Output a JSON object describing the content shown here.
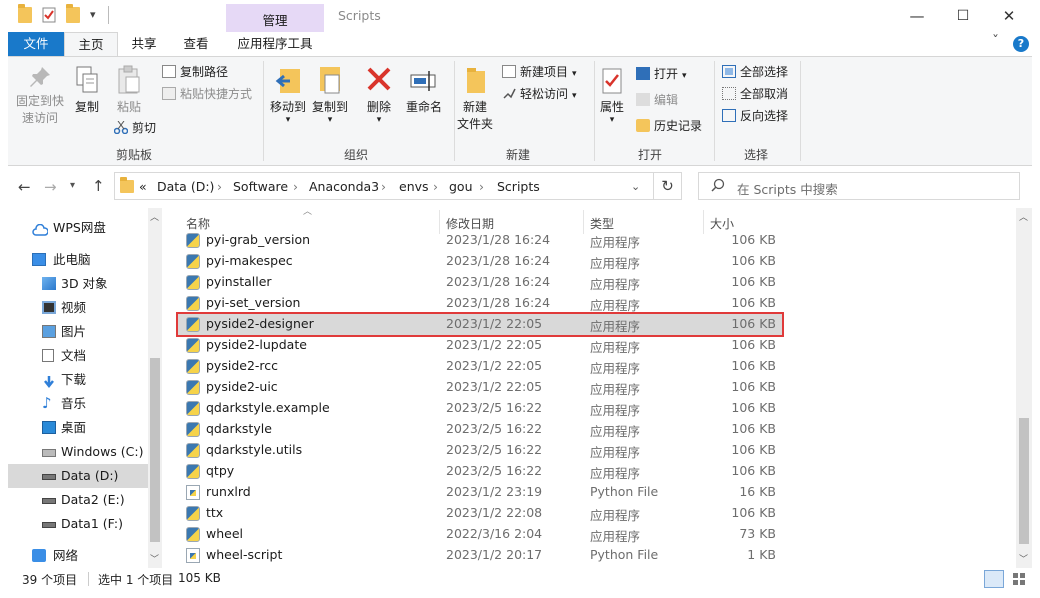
{
  "window": {
    "context_tab": "管理",
    "title": "Scripts",
    "minimize": "—",
    "maximize": "☐",
    "close": "✕"
  },
  "tabs": {
    "file": "文件",
    "home": "主页",
    "share": "共享",
    "view": "查看",
    "app_tools": "应用程序工具",
    "collapse": "ˇ",
    "help": "?"
  },
  "ribbon": {
    "pin_line1": "固定到快",
    "pin_line2": "速访问",
    "copy": "复制",
    "paste": "粘贴",
    "copy_path": "复制路径",
    "paste_shortcut": "粘贴快捷方式",
    "cut": "剪切",
    "clipboard_group": "剪贴板",
    "move_to": "移动到",
    "copy_to": "复制到",
    "delete": "删除",
    "rename": "重命名",
    "organize_group": "组织",
    "new_folder_line1": "新建",
    "new_folder_line2": "文件夹",
    "new_item": "新建项目",
    "easy_access": "轻松访问",
    "new_group": "新建",
    "properties": "属性",
    "open": "打开",
    "edit": "编辑",
    "history": "历史记录",
    "open_group": "打开",
    "select_all": "全部选择",
    "select_none": "全部取消",
    "invert_selection": "反向选择",
    "select_group": "选择"
  },
  "address": {
    "overflow": "«",
    "crumbs": [
      "Data (D:)",
      "Software",
      "Anaconda3",
      "envs",
      "gou",
      "Scripts"
    ],
    "search_placeholder": "在 Scripts 中搜索"
  },
  "nav": {
    "items": [
      {
        "label": "WPS网盘"
      },
      {
        "label": "此电脑"
      },
      {
        "label": "3D 对象"
      },
      {
        "label": "视频"
      },
      {
        "label": "图片"
      },
      {
        "label": "文档"
      },
      {
        "label": "下载"
      },
      {
        "label": "音乐"
      },
      {
        "label": "桌面"
      },
      {
        "label": "Windows (C:)"
      },
      {
        "label": "Data (D:)"
      },
      {
        "label": "Data2 (E:)"
      },
      {
        "label": "Data1 (F:)"
      },
      {
        "label": "网络"
      }
    ]
  },
  "columns": {
    "name": "名称",
    "date": "修改日期",
    "type": "类型",
    "size": "大小"
  },
  "files": [
    {
      "name": "pyi-grab_version",
      "date": "2023/1/28 16:24",
      "type": "应用程序",
      "size": "106 KB",
      "icon": "python-exe-icon"
    },
    {
      "name": "pyi-makespec",
      "date": "2023/1/28 16:24",
      "type": "应用程序",
      "size": "106 KB",
      "icon": "python-exe-icon"
    },
    {
      "name": "pyinstaller",
      "date": "2023/1/28 16:24",
      "type": "应用程序",
      "size": "106 KB",
      "icon": "python-exe-icon"
    },
    {
      "name": "pyi-set_version",
      "date": "2023/1/28 16:24",
      "type": "应用程序",
      "size": "106 KB",
      "icon": "python-exe-icon"
    },
    {
      "name": "pyside2-designer",
      "date": "2023/1/2 22:05",
      "type": "应用程序",
      "size": "106 KB",
      "icon": "python-exe-icon"
    },
    {
      "name": "pyside2-lupdate",
      "date": "2023/1/2 22:05",
      "type": "应用程序",
      "size": "106 KB",
      "icon": "python-exe-icon"
    },
    {
      "name": "pyside2-rcc",
      "date": "2023/1/2 22:05",
      "type": "应用程序",
      "size": "106 KB",
      "icon": "python-exe-icon"
    },
    {
      "name": "pyside2-uic",
      "date": "2023/1/2 22:05",
      "type": "应用程序",
      "size": "106 KB",
      "icon": "python-exe-icon"
    },
    {
      "name": "qdarkstyle.example",
      "date": "2023/2/5 16:22",
      "type": "应用程序",
      "size": "106 KB",
      "icon": "python-exe-icon"
    },
    {
      "name": "qdarkstyle",
      "date": "2023/2/5 16:22",
      "type": "应用程序",
      "size": "106 KB",
      "icon": "python-exe-icon"
    },
    {
      "name": "qdarkstyle.utils",
      "date": "2023/2/5 16:22",
      "type": "应用程序",
      "size": "106 KB",
      "icon": "python-exe-icon"
    },
    {
      "name": "qtpy",
      "date": "2023/2/5 16:22",
      "type": "应用程序",
      "size": "106 KB",
      "icon": "python-exe-icon"
    },
    {
      "name": "runxlrd",
      "date": "2023/1/2 23:19",
      "type": "Python File",
      "size": "16 KB",
      "icon": "python-file-icon"
    },
    {
      "name": "ttx",
      "date": "2023/1/2 22:08",
      "type": "应用程序",
      "size": "106 KB",
      "icon": "python-exe-icon"
    },
    {
      "name": "wheel",
      "date": "2022/3/16 2:04",
      "type": "应用程序",
      "size": "73 KB",
      "icon": "python-exe-icon"
    },
    {
      "name": "wheel-script",
      "date": "2023/1/2 20:17",
      "type": "Python File",
      "size": "1 KB",
      "icon": "python-file-icon"
    }
  ],
  "selected_file": "pyside2-designer",
  "status": {
    "count": "39 个项目",
    "selection": "选中 1 个项目",
    "size": "105 KB"
  }
}
